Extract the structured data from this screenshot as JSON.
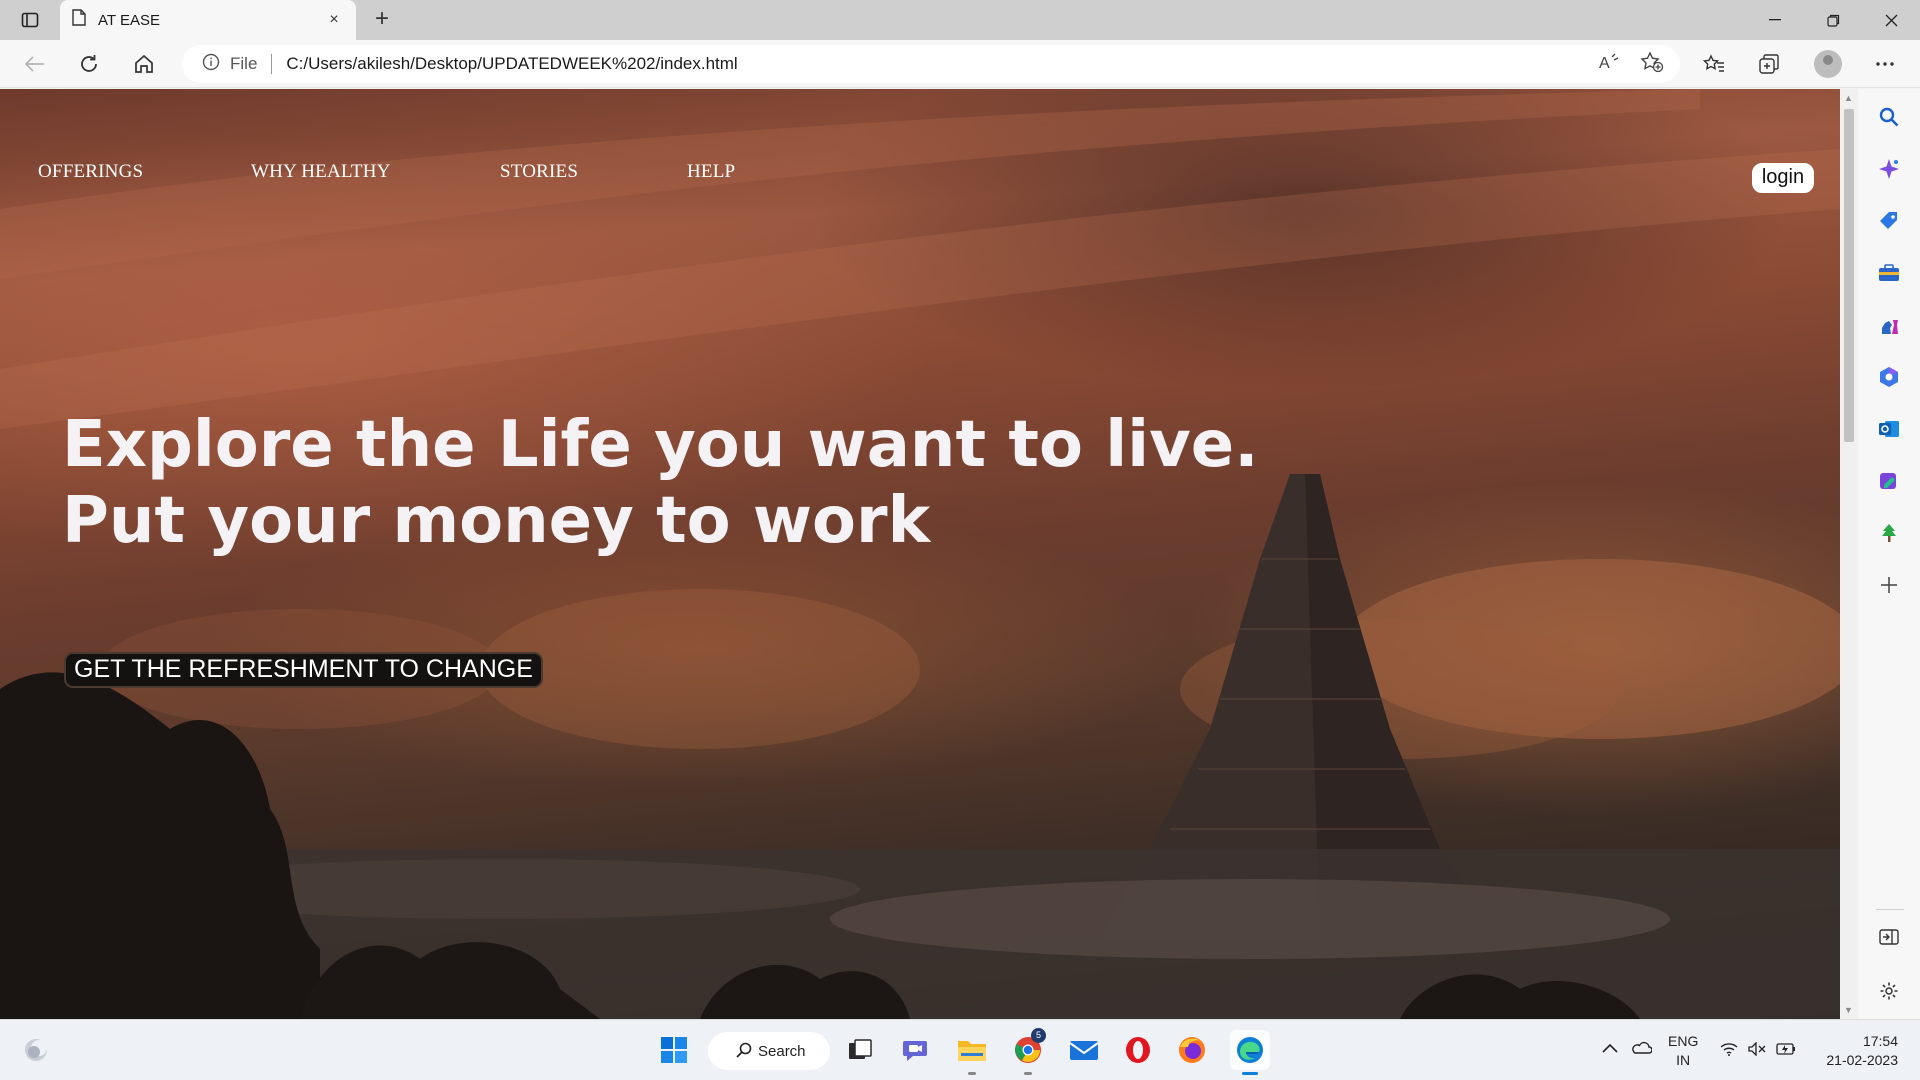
{
  "browser": {
    "tab_title": "AT EASE",
    "close_tab": "×",
    "new_tab": "+",
    "address": {
      "scheme_label": "File",
      "url": "C:/Users/akilesh/Desktop/UPDATEDWEEK%202/index.html"
    }
  },
  "page": {
    "nav": {
      "items": [
        "OFFERINGS",
        "WHY HEALTHY",
        "STORIES",
        "HELP"
      ],
      "login": "login"
    },
    "hero": {
      "line1": "Explore the Life you want to live.",
      "line2": "Put your money to work",
      "cta": "GET THE REFRESHMENT TO CHANGE"
    }
  },
  "taskbar": {
    "search_label": "Search",
    "chrome_badge": "5",
    "lang_line1": "ENG",
    "lang_line2": "IN",
    "time": "17:54",
    "date": "21-02-2023"
  },
  "colors": {
    "hero_text": "#f4f2f5",
    "cta_bg": "#141111",
    "sky_orange": "#9c5840"
  }
}
